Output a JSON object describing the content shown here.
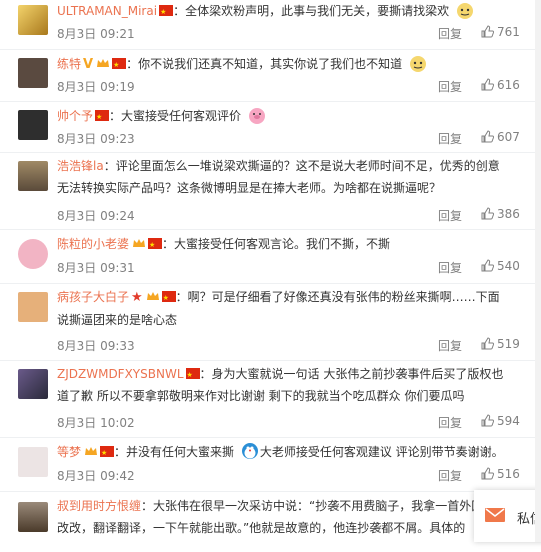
{
  "comments": [
    {
      "username": "ULTRAMAN_Mirai",
      "text": "：全体梁欢粉声明，此事与我们无关，要撕请找梁欢",
      "time": "8月3日 09:21",
      "reply": "回复",
      "likes": "761",
      "avatar_color": "#caa23b"
    },
    {
      "username": "练特",
      "text": "：你不说我们还真不知道，其实你说了我们也不知道",
      "time": "8月3日 09:19",
      "reply": "回复",
      "likes": "616",
      "avatar_color": "#6b5a4e"
    },
    {
      "username": "帅个予",
      "text": "：大蜜接受任何客观评价",
      "time": "8月3日 09:23",
      "reply": "回复",
      "likes": "607",
      "avatar_color": "#3a3a3a"
    },
    {
      "username": "浩浩锋la",
      "text": "：评论里面怎么一堆说梁欢撕逼的？这不是说大老师时间不足，优秀的创意无法转换实际产品吗？这条微博明显是在捧大老师。为啥都在说撕逼呢？",
      "time": "8月3日 09:24",
      "reply": "回复",
      "likes": "386",
      "avatar_color": "#8a7a5a"
    },
    {
      "username": "陈粒的小老婆",
      "text": "：大蜜接受任何客观言论。我们不撕，不撕",
      "time": "8月3日 09:31",
      "reply": "回复",
      "likes": "540",
      "avatar_color": "#e88aa0"
    },
    {
      "username": "病孩子大白子",
      "text": "：啊？可是仔细看了好像还真没有张伟的粉丝来撕啊……下面说撕逼团来的是啥心态",
      "time": "8月3日 09:33",
      "reply": "回复",
      "likes": "519",
      "avatar_color": "#d9a36a"
    },
    {
      "username": "ZJDZWMDFXYSBNWL",
      "text": "：身为大蜜就说一句话 大张伟之前抄袭事件后买了版权也道了歉 所以不要拿郭敬明来作对比谢谢 剩下的我就当个吃瓜群众 你们要瓜吗",
      "time": "8月3日 10:02",
      "reply": "回复",
      "likes": "594",
      "avatar_color": "#4a4a6a"
    },
    {
      "username": "等梦",
      "text": "：并没有任何大蜜来撕",
      "text2": "大老师接受任何客观建议 评论别带节奏谢谢。",
      "time": "8月3日 09:42",
      "reply": "回复",
      "likes": "516",
      "avatar_color": "#e6dede"
    },
    {
      "username": "叔到用时方恨缠",
      "text": "：大张伟在很早一次采访中说：“抄袭不用费脑子，我拿一首外国歌，改改，翻译翻译，一下午就能出歌。”他就是故意的，他连抄袭都不屑。具体的",
      "avatar_color": "#7a6a5a"
    }
  ],
  "message_bar": {
    "label": "私信",
    "icon": "envelope-icon",
    "accent": "#f0784a"
  },
  "colors": {
    "username": "#eb7350",
    "meta": "#808080",
    "text": "#333333"
  }
}
